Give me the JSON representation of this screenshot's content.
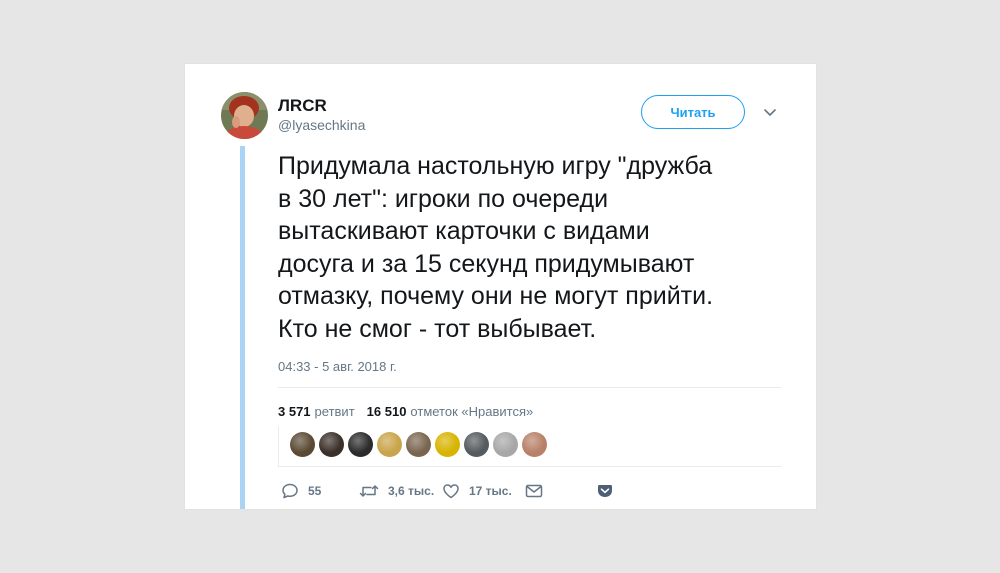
{
  "tweet": {
    "author_name": "ЛRCR",
    "author_handle": "@lyasechkina",
    "follow_label": "Читать",
    "text": "Придумала настольную игру \"дружба\nв 30 лет\": игроки по очереди\nвытаскивают карточки с видами\nдосуга и за 15 секунд придумывают\nотмазку, почему они не могут прийти.\nКто не смог - тот выбывает.",
    "timestamp": "04:33 - 5 авг. 2018 г.",
    "stats": {
      "retweet_count": "3 571",
      "retweet_label": "ретвит",
      "like_count": "16 510",
      "like_label": "отметок «Нравится»"
    },
    "actions": {
      "replies": "55",
      "retweets": "3,6 тыс.",
      "likes": "17 тыс."
    }
  },
  "likers": [
    {
      "name": "liker-1",
      "color": "#5a4a33"
    },
    {
      "name": "liker-2",
      "color": "#3b3029"
    },
    {
      "name": "liker-3",
      "color": "#2b2b2b"
    },
    {
      "name": "liker-4",
      "color": "#c9a44a"
    },
    {
      "name": "liker-5",
      "color": "#7a6650"
    },
    {
      "name": "liker-6",
      "color": "#d7b400"
    },
    {
      "name": "liker-7",
      "color": "#555a5e"
    },
    {
      "name": "liker-8",
      "color": "#a7a7a7"
    },
    {
      "name": "liker-9",
      "color": "#b88068"
    }
  ],
  "colors": {
    "accent": "#1da1f2",
    "thread": "#a9d4f5",
    "muted": "#657786"
  },
  "icons": [
    "chevron-down-icon",
    "reply-icon",
    "retweet-icon",
    "heart-icon",
    "message-icon",
    "pocket-icon"
  ]
}
